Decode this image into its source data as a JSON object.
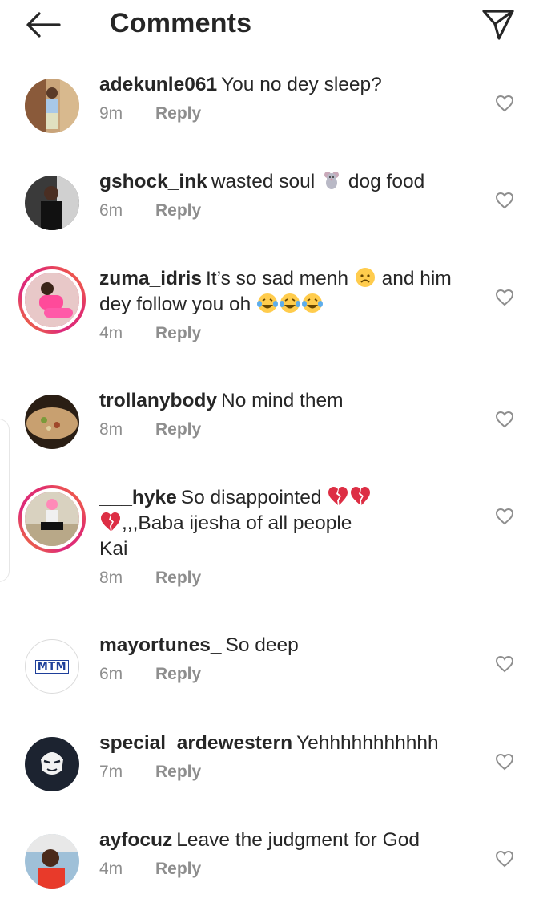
{
  "header": {
    "title": "Comments",
    "back_icon": "arrow-left-icon",
    "send_icon": "paper-plane-icon"
  },
  "reply_label": "Reply",
  "colors": {
    "text": "#262626",
    "muted": "#8e8e8e",
    "story_ring": "#dd2a7b"
  },
  "comments": [
    {
      "username": "adekunle061",
      "text": "You no dey sleep?",
      "time": "9m"
    },
    {
      "username": "gshock_ink",
      "text_a": "wasted soul",
      "text_b": "dog food",
      "emoji": "rat-emoji",
      "time": "6m"
    },
    {
      "username": "zuma_idris",
      "text_a": "It’s so sad menh",
      "text_b": "and him dey follow you oh",
      "emoji_a": "sad-face-emoji",
      "emoji_b": "laughing-tears-emoji",
      "time": "4m"
    },
    {
      "username": "trollanybody",
      "text": "No mind them",
      "time": "8m"
    },
    {
      "username": "___hyke",
      "text_a": "So disappointed",
      "text_b": ",,,Baba ijesha of all people",
      "text_c": "Kai",
      "emoji": "broken-heart-emoji",
      "time": "8m"
    },
    {
      "username": "mayortunes_",
      "text": "So deep",
      "avatar_text": "MTM",
      "time": "6m"
    },
    {
      "username": "special_ardewestern",
      "text": "Yehhhhhhhhhhh",
      "time": "7m"
    },
    {
      "username": "ayfocuz",
      "text": "Leave the judgment for God",
      "time": "4m"
    }
  ]
}
